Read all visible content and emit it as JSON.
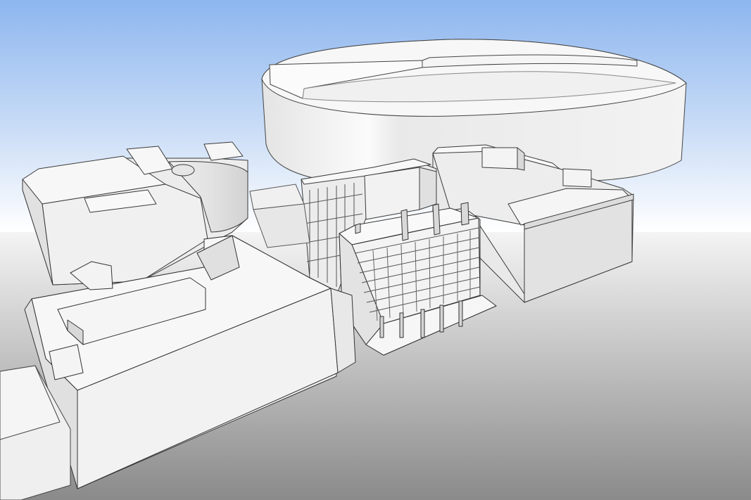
{
  "scene": {
    "description_type": "3d-massing-model-render",
    "colors": {
      "sky_top": "#8fb8ef",
      "sky_horizon": "#ffffff",
      "ground_near": "#8c8c8c",
      "ground_far": "#f2f2f2",
      "building_light": "#f6f6f6",
      "building_mid": "#e8e8e8",
      "building_shade": "#d6d6d6",
      "edge": "#3a3a3a"
    }
  }
}
